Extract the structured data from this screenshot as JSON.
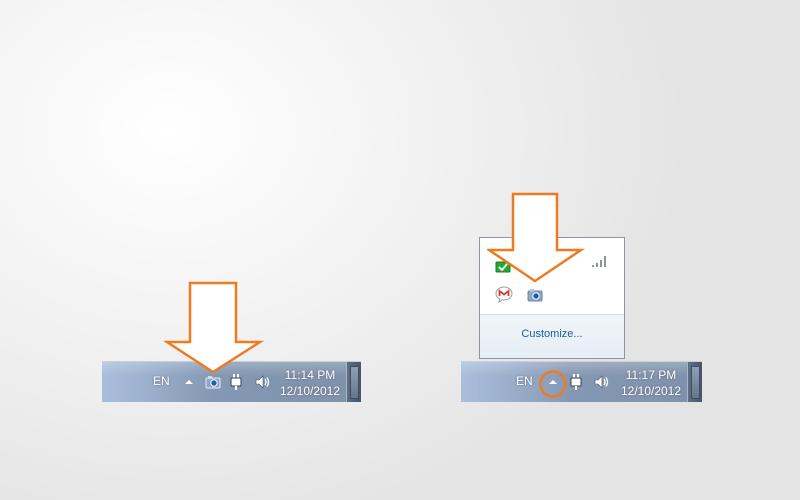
{
  "left_taskbar": {
    "language": "EN",
    "clock_time": "11:14 PM",
    "clock_date": "12/10/2012"
  },
  "right_taskbar": {
    "language": "EN",
    "clock_time": "11:17 PM",
    "clock_date": "12/10/2012"
  },
  "overflow_popup": {
    "icons": [
      "green-status-icon",
      "signal-bars-icon",
      "gmail-notifier-icon",
      "camera-icon"
    ],
    "customize_label": "Customize..."
  },
  "icons": {
    "show_hidden": "up-triangle-icon",
    "camera": "camera-icon",
    "power": "power-plug-icon",
    "volume": "speaker-icon"
  },
  "colors": {
    "highlight": "#f07a1e",
    "taskbar_text": "#ffffff",
    "link": "#1e5aa0"
  }
}
